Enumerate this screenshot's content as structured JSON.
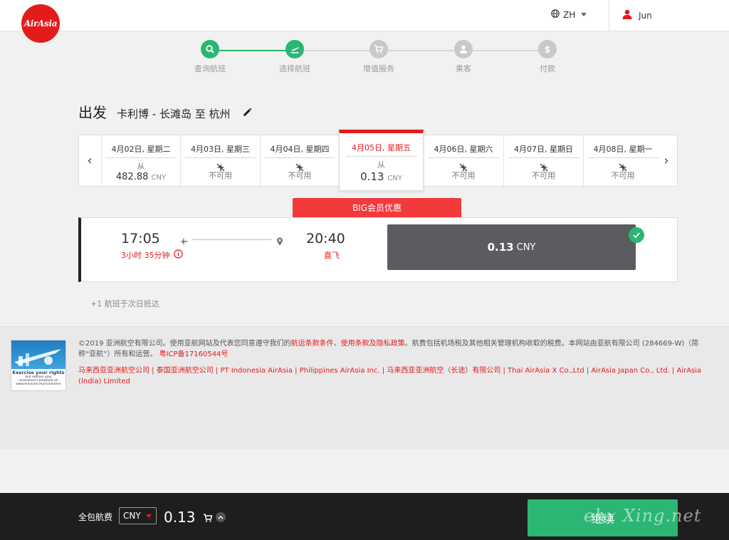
{
  "header": {
    "logo_text": "AirAsia",
    "language": "ZH",
    "user_name": "Jun"
  },
  "stepper": {
    "steps": [
      {
        "label": "查询航班",
        "icon": "search-icon",
        "state": "done"
      },
      {
        "label": "选择航班",
        "icon": "plane-depart-icon",
        "state": "active"
      },
      {
        "label": "增值服务",
        "icon": "cart-icon",
        "state": "pending"
      },
      {
        "label": "乘客",
        "icon": "person-icon",
        "state": "pending"
      },
      {
        "label": "付款",
        "icon": "dollar-icon",
        "state": "pending"
      }
    ]
  },
  "title": {
    "direction": "出发",
    "route": "卡利博 - 长滩岛 至 杭州"
  },
  "dates": [
    {
      "date": "4月02日, 星期二",
      "sub": "从",
      "price": "482.88",
      "currency": "CNY",
      "available": true
    },
    {
      "date": "4月03日, 星期三",
      "sub": "不可用",
      "available": false
    },
    {
      "date": "4月04日, 星期四",
      "sub": "不可用",
      "available": false
    },
    {
      "date": "4月05日, 星期五",
      "sub": "从",
      "price": "0.13",
      "currency": "CNY",
      "available": true,
      "selected": true
    },
    {
      "date": "4月06日, 星期六",
      "sub": "不可用",
      "available": false
    },
    {
      "date": "4月07日, 星期日",
      "sub": "不可用",
      "available": false
    },
    {
      "date": "4月08日, 星期一",
      "sub": "不可用",
      "available": false
    }
  ],
  "promo": {
    "banner": "BIG会员优惠"
  },
  "flight": {
    "depart_time": "17:05",
    "duration": "3小时 35分钟",
    "arrive_time": "20:40",
    "stops": "直飞",
    "fare": "0.13",
    "fare_currency": "CNY"
  },
  "next_day_note": "+1 航班于次日抵达",
  "footer": {
    "badge_title": "Exercise your rights",
    "badge_line1": "and redress your",
    "badge_line2": "unresolved complaint at:",
    "badge_line3": "www.mavcom.my/consumer",
    "legal_1": "©2019 亚洲航空有限公司。使用亚航网站及代表您同意遵守我们的",
    "legal_link1": "航运条款条件",
    "legal_sep1": "、",
    "legal_link2": "使用条款及隐私政策",
    "legal_2": "。航费包括机场税及其他相关管理机构收取的税费。本网站由亚航有限公司 (284669-W)（简称“亚航”）所有和运营。",
    "legal_icp": "粤ICP备17160544号",
    "companies": "马来西亚亚洲航空公司 | 泰国亚洲航空公司 | PT Indonesia AirAsia | Philippines AirAsia Inc. | 马来西亚亚洲航空（长途）有限公司 | Thai AirAsia X Co.,Ltd  | AirAsia Japan Co., Ltd. | AirAsia (India) Limited"
  },
  "bottom_bar": {
    "label": "全包航费",
    "currency": "CNY",
    "total": "0.13",
    "continue_label": "继续",
    "watermark": "ehx Xing.net"
  },
  "colors": {
    "brand_red": "#e41b1b",
    "green": "#2bb673",
    "fare_gray": "#5a5c5f",
    "bar_dark": "#1e1e1e"
  }
}
